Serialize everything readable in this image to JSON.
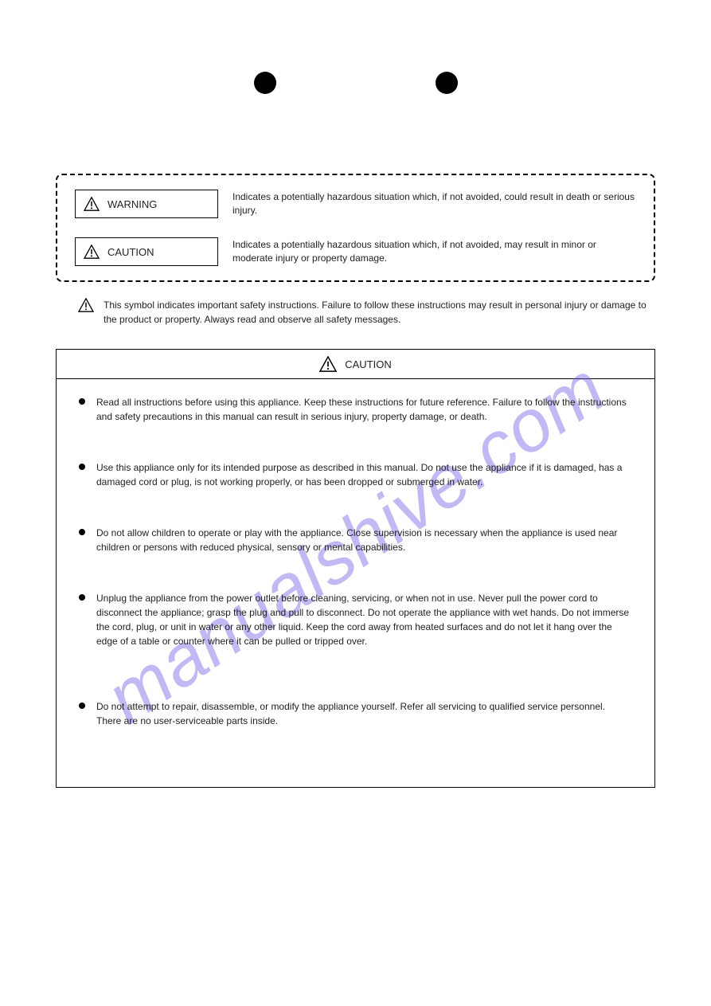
{
  "watermark": "manualshive.com",
  "dashed": {
    "rows": [
      {
        "label": "WARNING",
        "desc": "Indicates a potentially hazardous situation which, if not avoided, could result in death or serious injury."
      },
      {
        "label": "CAUTION",
        "desc": "Indicates a potentially hazardous situation which, if not avoided, may result in minor or moderate injury or property damage."
      }
    ]
  },
  "below_dashed": "This symbol indicates important safety instructions. Failure to follow these instructions may result in personal injury or damage to the product or property. Always read and observe all safety messages.",
  "solid_box": {
    "header": "CAUTION",
    "items": [
      "Read all instructions before using this appliance. Keep these instructions for future reference. Failure to follow the instructions and safety precautions in this manual can result in serious injury, property damage, or death.",
      "Use this appliance only for its intended purpose as described in this manual. Do not use the appliance if it is damaged, has a damaged cord or plug, is not working properly, or has been dropped or submerged in water.",
      "Do not allow children to operate or play with the appliance. Close supervision is necessary when the appliance is used near children or persons with reduced physical, sensory or mental capabilities.",
      "Unplug the appliance from the power outlet before cleaning, servicing, or when not in use. Never pull the power cord to disconnect the appliance; grasp the plug and pull to disconnect. Do not operate the appliance with wet hands. Do not immerse the cord, plug, or unit in water or any other liquid. Keep the cord away from heated surfaces and do not let it hang over the edge of a table or counter where it can be pulled or tripped over.",
      "Do not attempt to repair, disassemble, or modify the appliance yourself. Refer all servicing to qualified service personnel. There are no user-serviceable parts inside."
    ]
  }
}
